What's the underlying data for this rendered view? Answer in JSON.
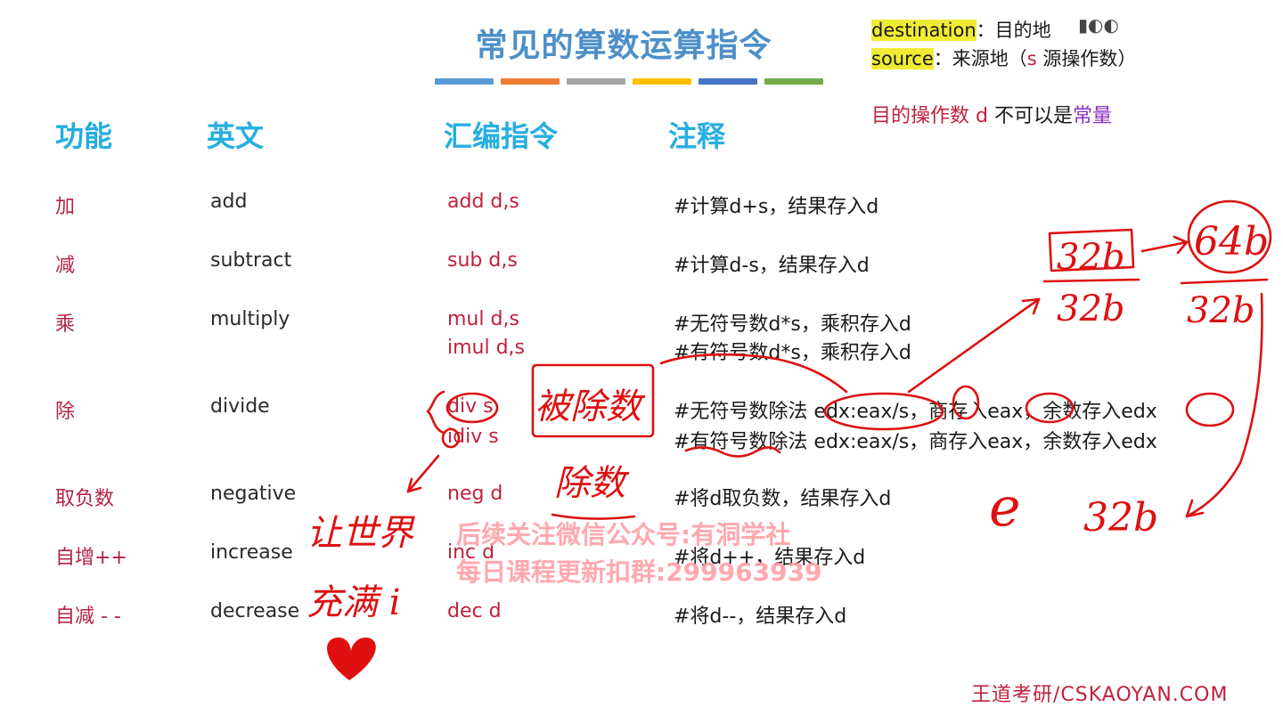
{
  "title": "常见的算数运算指令",
  "title_bar_colors": [
    "#5b9bd5",
    "#ed7d31",
    "#a5a5a5",
    "#ffc000",
    "#4472c4",
    "#70ad47"
  ],
  "legend": {
    "dest_key": "destination",
    "dest_text": "：目的地",
    "src_key": "source",
    "src_colon": "：来源地（",
    "src_d": "s",
    "src_rest": " 源操作数）"
  },
  "note": {
    "part1": "目的操作数 ",
    "d": "d",
    "part2": " 不可以是",
    "part3": "常量"
  },
  "headers": {
    "func": "功能",
    "eng": "英文",
    "asm": "汇编指令",
    "cmt": "注释"
  },
  "rows": [
    {
      "func": "加",
      "eng": "add",
      "asm": "add d,s",
      "cmt": "#计算d+s，结果存入d"
    },
    {
      "func": "减",
      "eng": "subtract",
      "asm": "sub d,s",
      "cmt": "#计算d-s，结果存入d"
    },
    {
      "func": "乘",
      "eng": "multiply",
      "asm": "mul d,s",
      "cmt": "#无符号数d*s，乘积存入d",
      "asm2": "imul d,s",
      "cmt2": "#有符号数d*s，乘积存入d"
    },
    {
      "func": "除",
      "eng": "divide",
      "asm": "div s",
      "cmt": "#无符号数除法 edx:eax/s，商存入eax，余数存入edx",
      "asm2": "idiv s",
      "cmt2": "#有符号数除法 edx:eax/s，商存入eax，余数存入edx"
    },
    {
      "func": "取负数",
      "eng": "negative",
      "asm": "neg d",
      "cmt": "#将d取负数，结果存入d"
    },
    {
      "func": "自增++",
      "eng": "increase",
      "asm": "inc d",
      "cmt": "#将d++，结果存入d"
    },
    {
      "func": "自减 - -",
      "eng": "decrease",
      "asm": "dec d",
      "cmt": "#将d--，结果存入d"
    }
  ],
  "watermark": {
    "line1": "后续关注微信公众号:有洞学社",
    "line2": "每日课程更新扣群:299963939"
  },
  "footer": "王道考研/CSKAOYAN.COM",
  "handwriting": {
    "dividend": "被除数",
    "divisor": "除数",
    "top_left": "32b",
    "top_right": "64b",
    "bottom_left": "32b",
    "bottom_right": "32b",
    "e_label": "e",
    "e_value": "32b",
    "love1": "让世界",
    "love2": "充满 i"
  }
}
